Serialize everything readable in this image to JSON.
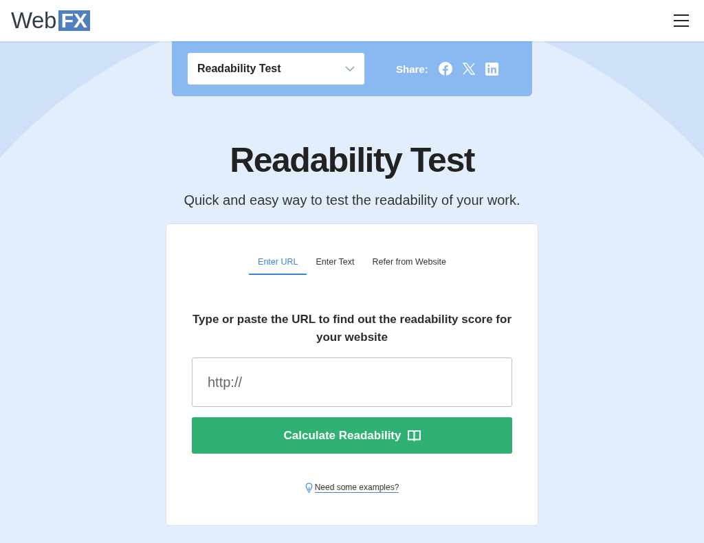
{
  "header": {
    "logo": {
      "word": "Web",
      "badge": "FX"
    }
  },
  "tool_bar": {
    "selector": {
      "value": "Readability Test"
    },
    "share_label": "Share:",
    "share_links": [
      {
        "kind": "facebook"
      },
      {
        "kind": "x"
      },
      {
        "kind": "linkedin"
      }
    ]
  },
  "title": "Readability Test",
  "subtitle": "Quick and easy way to test the readability of your work.",
  "card": {
    "tabs": [
      {
        "label": "Enter URL",
        "selected": true
      },
      {
        "label": "Enter Text",
        "selected": false
      },
      {
        "label": "Refer from Website",
        "selected": false
      }
    ],
    "instruction": "Type or paste the URL to find out the readability score for your website",
    "url_field": {
      "placeholder": "http://"
    },
    "button": "Calculate Readability",
    "examples_link": "Need some examples?"
  }
}
